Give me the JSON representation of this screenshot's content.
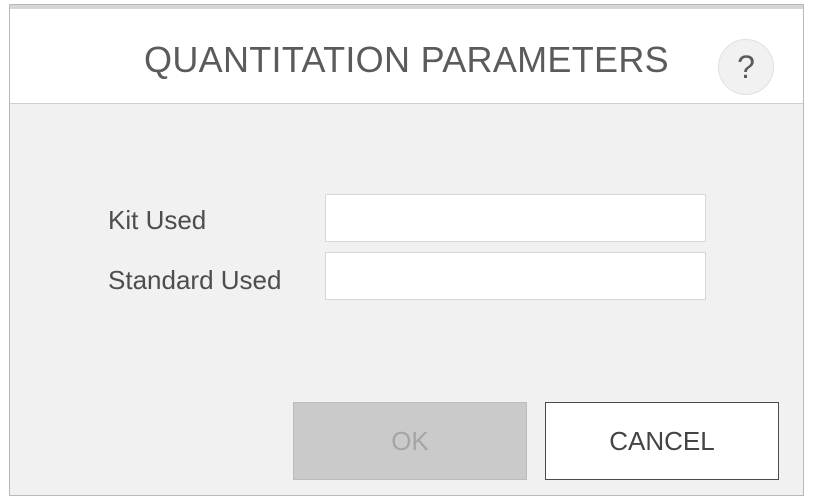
{
  "dialog": {
    "title": "QUANTITATION PARAMETERS",
    "help_label": "?"
  },
  "form": {
    "kit_label": "Kit Used",
    "kit_value": "",
    "standard_label": "Standard Used",
    "standard_value": ""
  },
  "buttons": {
    "ok_label": "OK",
    "ok_enabled": false,
    "cancel_label": "CANCEL"
  },
  "icons": {
    "help": "question-mark-icon"
  },
  "colors": {
    "dialog_body": "#f1f1f1",
    "header_bg": "#ffffff",
    "ok_disabled_bg": "#cacaca",
    "cancel_border": "#4a4a4a"
  }
}
